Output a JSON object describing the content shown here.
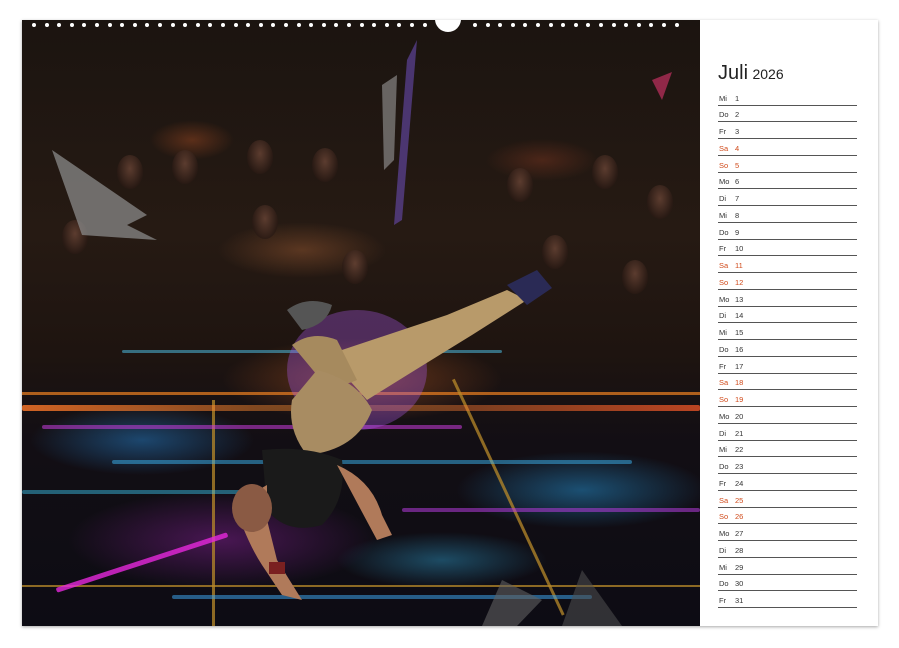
{
  "calendar": {
    "month": "Juli",
    "year": "2026",
    "days": [
      {
        "wd": "Mi",
        "d": "1",
        "we": false
      },
      {
        "wd": "Do",
        "d": "2",
        "we": false
      },
      {
        "wd": "Fr",
        "d": "3",
        "we": false
      },
      {
        "wd": "Sa",
        "d": "4",
        "we": true
      },
      {
        "wd": "So",
        "d": "5",
        "we": true
      },
      {
        "wd": "Mo",
        "d": "6",
        "we": false
      },
      {
        "wd": "Di",
        "d": "7",
        "we": false
      },
      {
        "wd": "Mi",
        "d": "8",
        "we": false
      },
      {
        "wd": "Do",
        "d": "9",
        "we": false
      },
      {
        "wd": "Fr",
        "d": "10",
        "we": false
      },
      {
        "wd": "Sa",
        "d": "11",
        "we": true
      },
      {
        "wd": "So",
        "d": "12",
        "we": true
      },
      {
        "wd": "Mo",
        "d": "13",
        "we": false
      },
      {
        "wd": "Di",
        "d": "14",
        "we": false
      },
      {
        "wd": "Mi",
        "d": "15",
        "we": false
      },
      {
        "wd": "Do",
        "d": "16",
        "we": false
      },
      {
        "wd": "Fr",
        "d": "17",
        "we": false
      },
      {
        "wd": "Sa",
        "d": "18",
        "we": true
      },
      {
        "wd": "So",
        "d": "19",
        "we": true
      },
      {
        "wd": "Mo",
        "d": "20",
        "we": false
      },
      {
        "wd": "Di",
        "d": "21",
        "we": false
      },
      {
        "wd": "Mi",
        "d": "22",
        "we": false
      },
      {
        "wd": "Do",
        "d": "23",
        "we": false
      },
      {
        "wd": "Fr",
        "d": "24",
        "we": false
      },
      {
        "wd": "Sa",
        "d": "25",
        "we": true
      },
      {
        "wd": "So",
        "d": "26",
        "we": true
      },
      {
        "wd": "Mo",
        "d": "27",
        "we": false
      },
      {
        "wd": "Di",
        "d": "28",
        "we": false
      },
      {
        "wd": "Mi",
        "d": "29",
        "we": false
      },
      {
        "wd": "Do",
        "d": "30",
        "we": false
      },
      {
        "wd": "Fr",
        "d": "31",
        "we": false
      }
    ]
  },
  "colors": {
    "weekend": "#d04a1a",
    "weekday": "#333333",
    "rule": "#555555"
  },
  "photo": {
    "icon": "breakdancer-photo"
  }
}
